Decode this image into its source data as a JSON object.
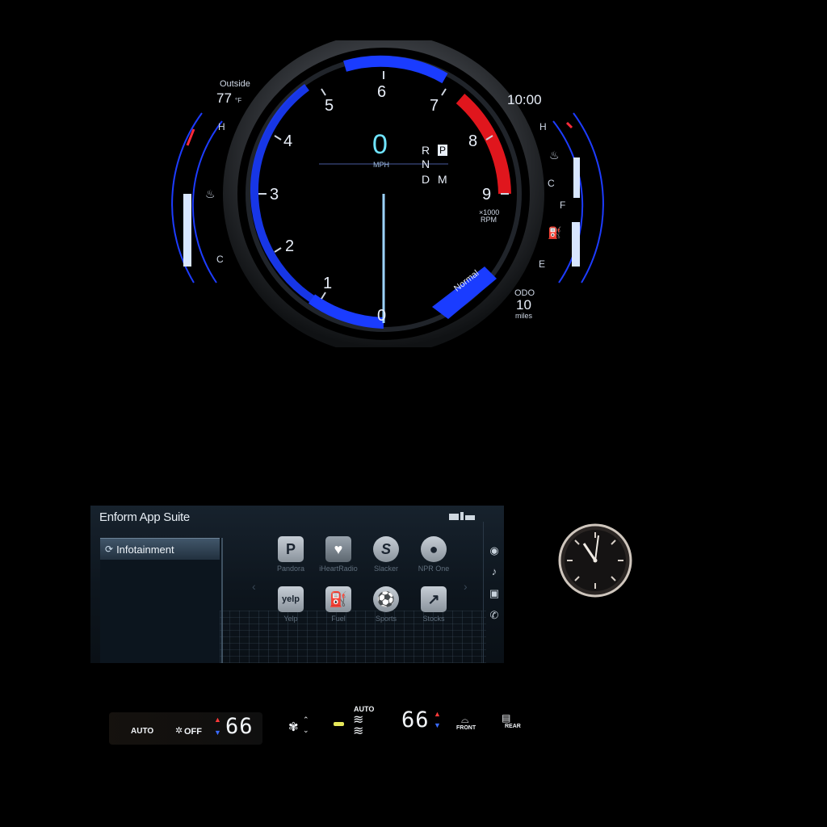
{
  "cluster": {
    "outside_label": "Outside",
    "outside_temp": "77",
    "temp_unit": "°F",
    "clock": "10:00",
    "speed": "0",
    "speed_unit": "MPH",
    "rpm_labels": [
      "0",
      "1",
      "2",
      "3",
      "4",
      "5",
      "6",
      "7",
      "8",
      "9"
    ],
    "rpm_unit_line1": "×1000",
    "rpm_unit_line2": "RPM",
    "gear_row1": "R",
    "gear_row2": "N",
    "gear_row3": "D",
    "gear_park": "P",
    "gear_manual": "M",
    "drive_mode": "Normal",
    "odo_label": "ODO",
    "odo_value": "10",
    "odo_unit": "miles",
    "left_gauge_hot": "H",
    "left_gauge_cold": "C",
    "right_gauge_hot": "H",
    "right_gauge_cold": "C",
    "fuel_full": "F",
    "fuel_empty": "E",
    "accent_blue": "#1a3cff",
    "redline": "#e0161d"
  },
  "infotainment": {
    "title": "Enform App Suite",
    "sidebar_item": "Infotainment",
    "apps_row1": [
      {
        "name": "Pandora",
        "icon": "pandora-icon",
        "glyph": "P"
      },
      {
        "name": "iHeartRadio",
        "icon": "iheartradio-icon",
        "glyph": "♥"
      },
      {
        "name": "Slacker",
        "icon": "slacker-icon",
        "glyph": "S"
      },
      {
        "name": "NPR One",
        "icon": "npr-one-icon",
        "glyph": "●"
      }
    ],
    "apps_row2": [
      {
        "name": "Yelp",
        "icon": "yelp-icon",
        "glyph": "yelp"
      },
      {
        "name": "Fuel",
        "icon": "fuel-icon",
        "glyph": "⛽"
      },
      {
        "name": "Sports",
        "icon": "sports-icon",
        "glyph": "⚽"
      },
      {
        "name": "Stocks",
        "icon": "stocks-icon",
        "glyph": "↗"
      }
    ],
    "rail_icons": [
      "navigation-icon",
      "music-note-icon",
      "image-icon",
      "phone-icon"
    ]
  },
  "climate": {
    "auto_label": "AUTO",
    "off_label": "OFF",
    "driver_temp": "66",
    "passenger_temp": "66",
    "fan_auto_label": "AUTO",
    "front_label": "FRONT",
    "rear_label": "REAR"
  }
}
